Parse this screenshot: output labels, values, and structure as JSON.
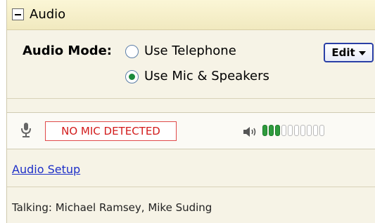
{
  "header": {
    "title": "Audio"
  },
  "audio_mode": {
    "label": "Audio Mode:",
    "options": [
      {
        "label": "Use Telephone",
        "selected": false
      },
      {
        "label": "Use Mic & Speakers",
        "selected": true
      }
    ],
    "edit_label": "Edit"
  },
  "mic": {
    "status": "NO MIC DETECTED",
    "status_color": "#d21b1b",
    "speaker_level": {
      "active_segments": 3,
      "total_segments": 10
    }
  },
  "audio_setup_link": "Audio Setup",
  "talking": "Talking: Michael Ramsey, Mike Suding"
}
